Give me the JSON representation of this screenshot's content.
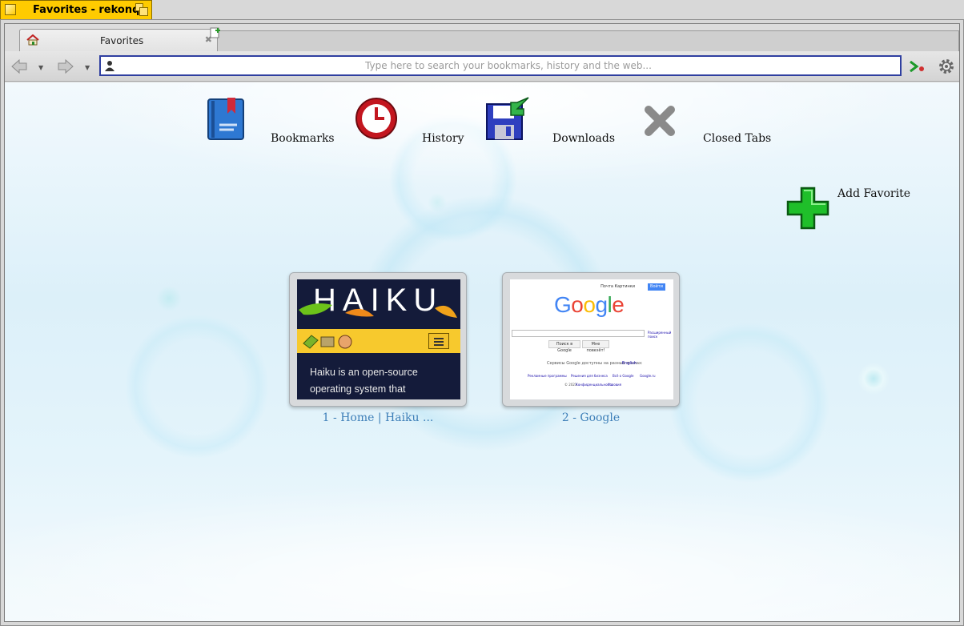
{
  "window": {
    "title": "Favorites - rekonq",
    "accent_color": "#ffcb00"
  },
  "tabs": [
    {
      "label": "Favorites",
      "icon": "home-icon",
      "active": true
    }
  ],
  "toolbar": {
    "back_icon": "back-arrow-icon",
    "forward_icon": "forward-arrow-icon",
    "url_placeholder": "Type here to search your bookmarks, history and the web...",
    "url_value": "",
    "go_icon": "go-arrow-icon",
    "settings_icon": "gear-icon"
  },
  "quicklinks": [
    {
      "label": "Bookmarks",
      "icon": "bookmarks-book-icon"
    },
    {
      "label": "History",
      "icon": "clock-icon"
    },
    {
      "label": "Downloads",
      "icon": "floppy-download-icon"
    },
    {
      "label": "Closed Tabs",
      "icon": "close-x-icon"
    }
  ],
  "add_favorite": {
    "label": "Add Favorite",
    "icon": "green-plus-icon"
  },
  "favorites": [
    {
      "label": "1 - Home | Haiku ...",
      "preview": {
        "logo_text": "HAIKU",
        "body_text": "Haiku is an open-source operating system that"
      }
    },
    {
      "label": "2 - Google",
      "preview": {
        "logo_text": "Google",
        "top_links": "Почта  Картинки",
        "signin": "Войти",
        "btn_search": "Поиск в Google",
        "btn_lucky": "Мне повезёт!",
        "languages": "Сервисы Google доступны на разных языках:",
        "lang_link": "English",
        "advanced": "Расширенный поиск",
        "footer_links": [
          "Рекламные программы",
          "Решения для бизнеса",
          "Всё о Google",
          "Google.ru"
        ],
        "copyright": "© 2021",
        "privacy": "Конфиденциальность",
        "terms": "Условия"
      }
    }
  ]
}
